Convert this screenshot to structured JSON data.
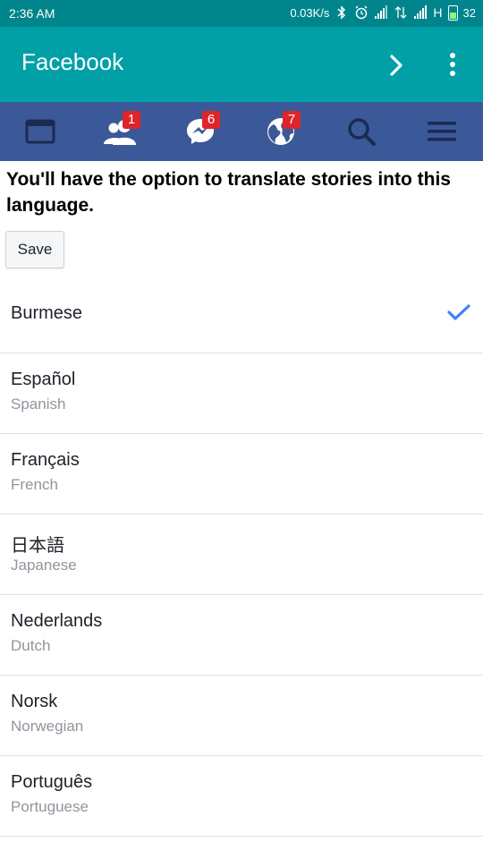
{
  "status_bar": {
    "time": "2:36 AM",
    "speed": "0.03K/s",
    "network": "H",
    "battery": "32"
  },
  "app_bar": {
    "title": "Facebook"
  },
  "fb_nav": {
    "friends_badge": "1",
    "messages_badge": "6",
    "notifications_badge": "7"
  },
  "prompt": "You'll have the option to translate stories into this language.",
  "save_label": "Save",
  "languages": [
    {
      "name": "Burmese",
      "sub": ""
    },
    {
      "name": "Español",
      "sub": "Spanish"
    },
    {
      "name": "Français",
      "sub": "French"
    },
    {
      "name": "日本語",
      "sub": "Japanese"
    },
    {
      "name": "Nederlands",
      "sub": "Dutch"
    },
    {
      "name": "Norsk",
      "sub": "Norwegian"
    },
    {
      "name": "Português",
      "sub": "Portuguese"
    }
  ],
  "colors": {
    "status_bar": "#00858c",
    "app_bar": "#00a0a6",
    "fb_nav": "#3b5998",
    "badge": "#e0252a",
    "check": "#4080ff"
  }
}
